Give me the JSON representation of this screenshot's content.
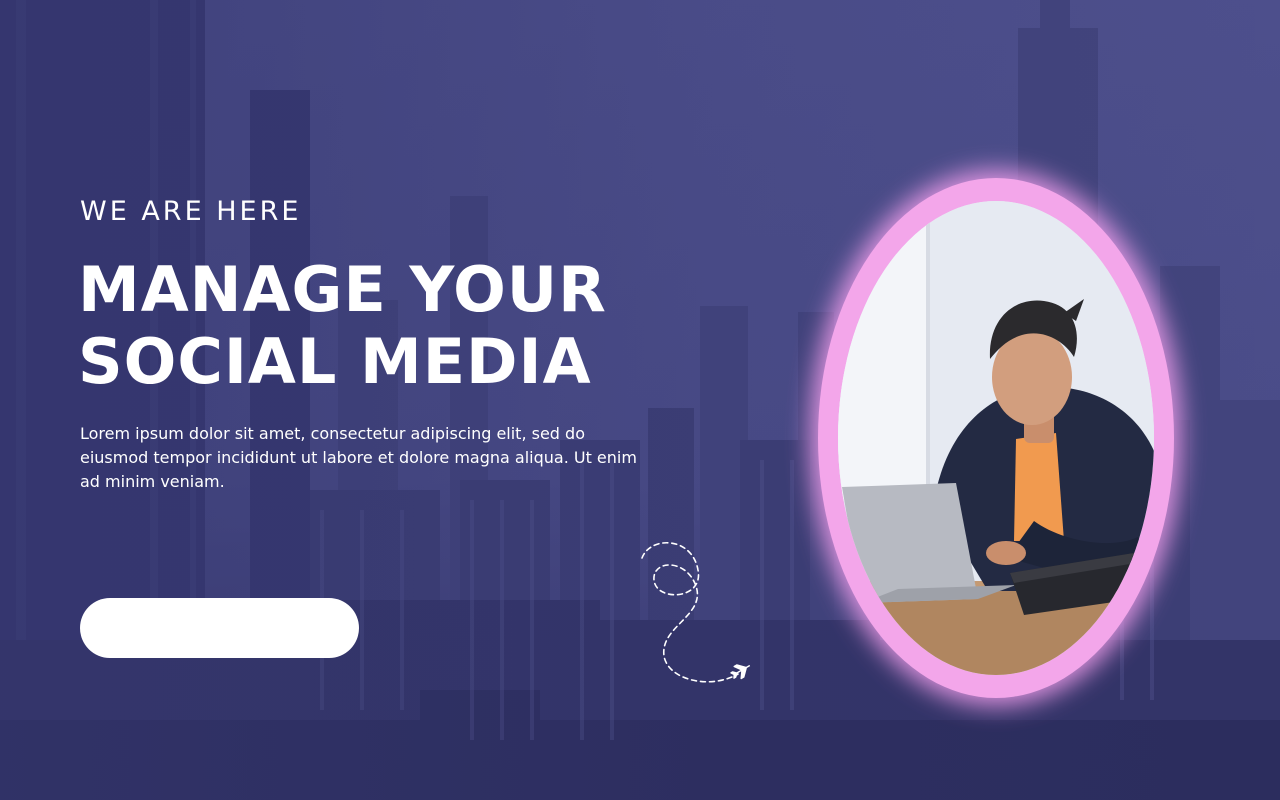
{
  "hero": {
    "eyebrow": "WE ARE HERE",
    "headline_line1": "MANAGE YOUR",
    "headline_line2": "SOCIAL MEDIA",
    "body": "Lorem ipsum dolor sit amet, consectetur adipiscing elit, sed do eiusmod tempor incididunt ut labore et dolore magna aliqua. Ut enim ad minim veniam."
  },
  "cta": {
    "label": ""
  },
  "colors": {
    "background": "#3f4179",
    "text": "#ffffff",
    "portrait_ring": "#f3a6ea",
    "button": "#ffffff"
  },
  "icons": {
    "path_decoration": "dashed-flight-path-icon",
    "plane": "airplane-icon"
  }
}
